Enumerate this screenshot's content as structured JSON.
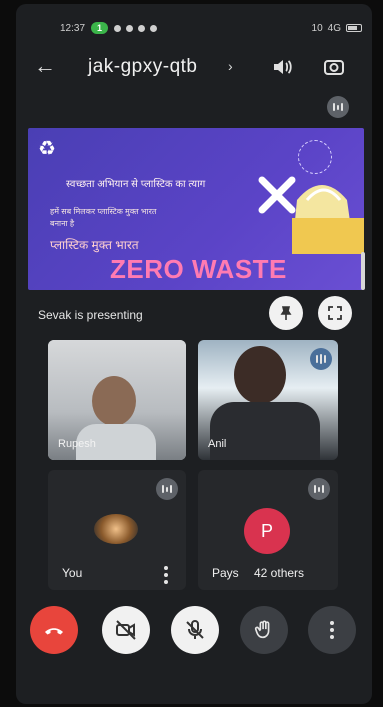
{
  "status_bar": {
    "time": "12:37",
    "pill_text": "1",
    "right_text": "10",
    "network": "4G"
  },
  "meeting": {
    "code": "jak-gpxy-qtb"
  },
  "slide": {
    "line1": "स्वच्छता अभियान से प्लास्टिक का त्याग",
    "line2": "हमें सब मिलकर प्लास्टिक मुक्त भारत",
    "line3": "बनाना है",
    "line4": "प्लास्टिक मुक्त भारत",
    "headline": "ZERO WASTE"
  },
  "presenting_text": "Sevak is presenting",
  "participants": {
    "tile1_name": "Rupesh",
    "tile2_name": "Anil",
    "you_label": "You",
    "others_label": "Pays",
    "others_count": "42 others",
    "avatar_letter": "P"
  },
  "colors": {
    "accent": "#e8453c",
    "slide_bg": "#5b44c7",
    "headline": "#ff7bb2",
    "avatar": "#d9334f"
  }
}
